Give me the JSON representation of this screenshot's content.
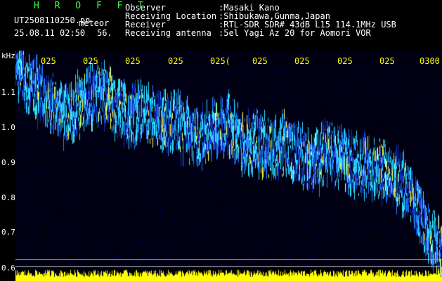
{
  "header": {
    "brand": "H R O F F T",
    "filename": "UT2508110250.pn",
    "meteor_label": "meteor",
    "datetime": "25.08.11 02:50",
    "count": "56.",
    "fields": [
      {
        "label": "Observer",
        "value": ":Masaki Kano"
      },
      {
        "label": "Receiving Location",
        "value": ":Shibukawa,Gunma,Japan"
      },
      {
        "label": "Receiver",
        "value": ":RTL-SDR SDR# 43dB L15 114.1MHz USB"
      },
      {
        "label": "Receiving antenna",
        "value": ":5el Yagi Az 20 for Aomori VOR"
      }
    ]
  },
  "chart_data": {
    "type": "heatmap",
    "y_unit_label": "kHz",
    "yticks": [
      "1.1",
      "1.0",
      "0.9",
      "0.8",
      "0.7",
      "0.6"
    ],
    "xticks": [
      "025",
      "025",
      "025",
      "025",
      "025(",
      "025",
      "025",
      "025",
      "025",
      "0300"
    ],
    "ylim": [
      0.58,
      1.19
    ],
    "trace_khz": [
      1.17,
      1.12,
      1.08,
      1.05,
      1.04,
      1.08,
      1.1,
      1.06,
      1.03,
      1.05,
      1.0,
      1.02,
      0.99,
      0.97,
      0.99,
      1.01,
      0.95,
      0.96,
      0.93,
      0.95,
      0.92,
      0.9,
      0.93,
      0.91,
      0.89,
      0.88,
      0.87,
      0.85,
      0.8,
      0.7,
      0.64
    ],
    "colors": {
      "strong": "#ffff40",
      "mid": "#30e0ff",
      "weak": "#1030c0",
      "noise_bar": "#ffff00",
      "grid": "#ffffff"
    }
  }
}
